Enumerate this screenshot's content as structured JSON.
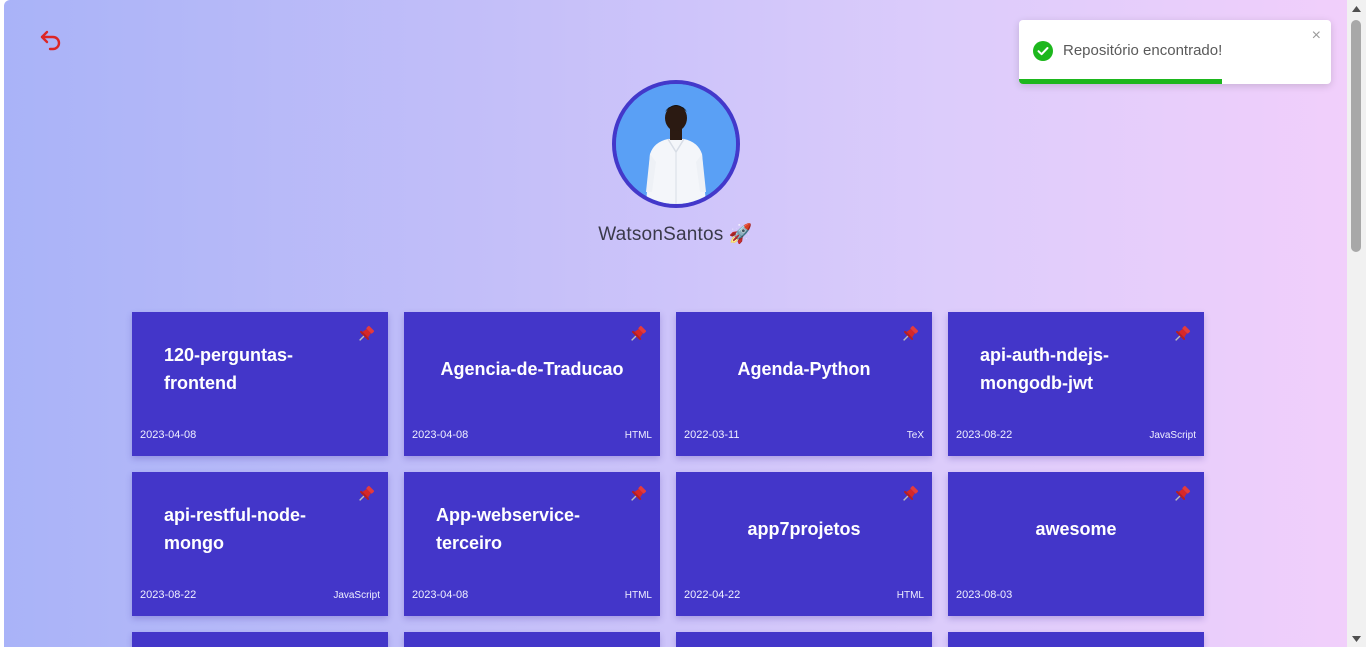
{
  "user": {
    "username": "WatsonSantos 🚀"
  },
  "toast": {
    "message": "Repositório encontrado!",
    "close_label": "×",
    "progress": 0.65,
    "success_color": "#1db71d"
  },
  "colors": {
    "card_bg": "#4336c9",
    "accent": "#4338ca",
    "back_icon": "#dc2626"
  },
  "icons": {
    "back": "undo-arrow-icon",
    "pin": "pushpin-icon",
    "check": "check-circle-icon",
    "close": "close-icon"
  },
  "repos": [
    {
      "name": "120-perguntas-frontend",
      "date": "2023-04-08",
      "language": ""
    },
    {
      "name": "Agencia-de-Traducao",
      "date": "2023-04-08",
      "language": "HTML"
    },
    {
      "name": "Agenda-Python",
      "date": "2022-03-11",
      "language": "TeX"
    },
    {
      "name": "api-auth-ndejs-mongodb-jwt",
      "date": "2023-08-22",
      "language": "JavaScript"
    },
    {
      "name": "api-restful-node-mongo",
      "date": "2023-08-22",
      "language": "JavaScript"
    },
    {
      "name": "App-webservice-terceiro",
      "date": "2023-04-08",
      "language": "HTML"
    },
    {
      "name": "app7projetos",
      "date": "2022-04-22",
      "language": "HTML"
    },
    {
      "name": "awesome",
      "date": "2023-08-03",
      "language": ""
    }
  ]
}
